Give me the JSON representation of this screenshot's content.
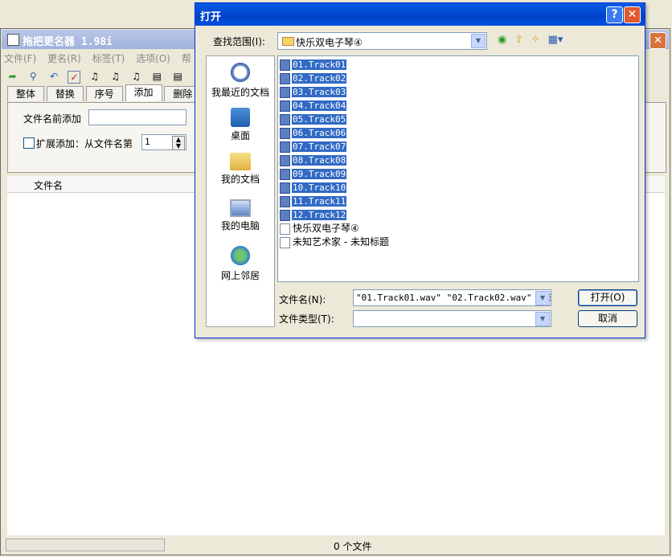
{
  "main": {
    "title": "拖把更名器 1.98i",
    "menus": [
      "文件(F)",
      "更名(R)",
      "标签(T)",
      "选项(O)",
      "帮"
    ],
    "tabs": [
      "整体",
      "替换",
      "序号",
      "添加",
      "删除"
    ],
    "prefix_label": "文件名前添加",
    "prefix_value": "",
    "ext_label": "扩展添加：从文件名第",
    "ext_spin_value": "1",
    "col_filename": "文件名",
    "status": "0 个文件"
  },
  "dialog": {
    "title": "打开",
    "help": "?",
    "close": "X",
    "lookin_label": "查找范围(I):",
    "lookin_value": "快乐双电子琴④",
    "places": [
      "我最近的文档",
      "桌面",
      "我的文档",
      "我的电脑",
      "网上邻居"
    ],
    "files_selected": [
      "01.Track01",
      "02.Track02",
      "03.Track03",
      "04.Track04",
      "05.Track05",
      "06.Track06",
      "07.Track07",
      "08.Track08",
      "09.Track09",
      "10.Track10",
      "11.Track11",
      "12.Track12"
    ],
    "files_other": [
      "快乐双电子琴④",
      "未知艺术家 - 未知标题"
    ],
    "filename_label": "文件名(N):",
    "filename_value": "\"01.Track01.wav\" \"02.Track02.wav\" \"03.",
    "filetype_label": "文件类型(T):",
    "filetype_value": "",
    "open_btn": "打开(O)",
    "cancel_btn": "取消"
  },
  "colors": {
    "selection": "#316ac5",
    "dialog_title": "#0a5ce8"
  }
}
